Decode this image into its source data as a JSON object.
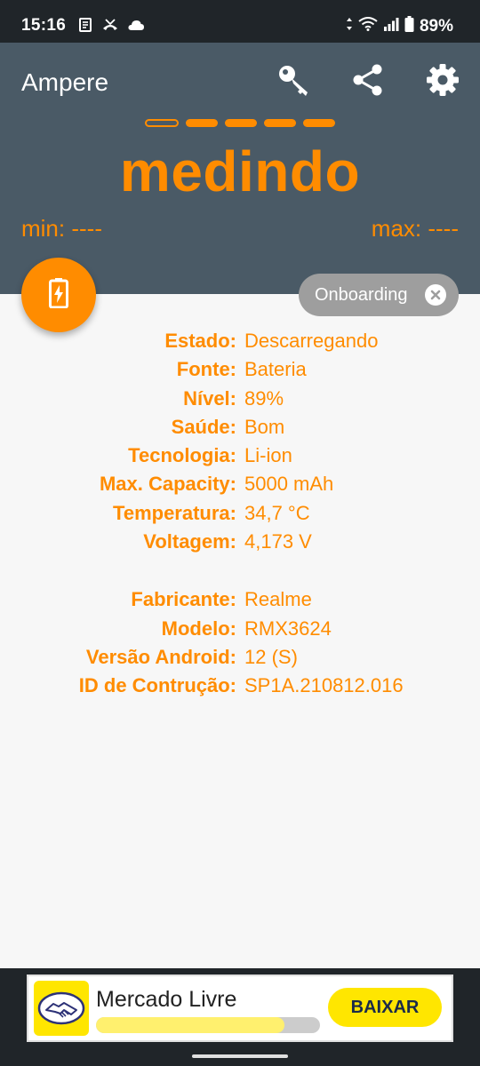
{
  "status_bar": {
    "time": "15:16",
    "battery_percent": "89%",
    "icons": [
      "news-icon",
      "missed-call-icon",
      "cloud-icon",
      "data-arrows-icon",
      "wifi-icon",
      "signal-icon",
      "battery-icon"
    ]
  },
  "header": {
    "title": "Ampere",
    "icons": [
      "key-icon",
      "share-icon",
      "gear-icon"
    ],
    "indicator": {
      "total": 5,
      "active": 4
    },
    "state": "medindo",
    "min": "min: ----",
    "max": "max: ----"
  },
  "onboarding_chip": {
    "label": "Onboarding"
  },
  "battery_info": [
    {
      "label": "Estado:",
      "value": "Descarregando"
    },
    {
      "label": "Fonte:",
      "value": "Bateria"
    },
    {
      "label": "Nível:",
      "value": "89%"
    },
    {
      "label": "Saúde:",
      "value": "Bom"
    },
    {
      "label": "Tecnologia:",
      "value": "Li-ion"
    },
    {
      "label": "Max. Capacity:",
      "value": "5000 mAh"
    },
    {
      "label": "Temperatura:",
      "value": "34,7 °C"
    },
    {
      "label": "Voltagem:",
      "value": "4,173 V"
    }
  ],
  "device_info": [
    {
      "label": "Fabricante:",
      "value": "Realme"
    },
    {
      "label": "Modelo:",
      "value": "RMX3624"
    },
    {
      "label": "Versão Android:",
      "value": "12 (S)"
    },
    {
      "label": "ID de Contrução:",
      "value": "SP1A.210812.016"
    }
  ],
  "ad": {
    "name": "Mercado Livre",
    "button": "BAIXAR",
    "progress": 0.84
  },
  "colors": {
    "accent": "#ff8c00",
    "header_bg": "#4a5a66",
    "status_bg": "#202529",
    "ad_yellow": "#ffe600"
  }
}
